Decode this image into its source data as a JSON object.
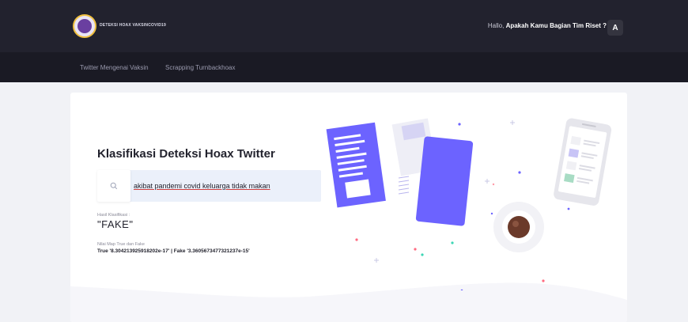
{
  "header": {
    "brand": "DETEKSI HOAX VAKSINCOVID19",
    "greeting_prefix": "Hallo,",
    "greeting_name": "Apakah Kamu Bagian Tim Riset ?",
    "avatar_letter": "A"
  },
  "nav": {
    "items": [
      {
        "label": "Twitter Mengenai Vaksin"
      },
      {
        "label": "Scrapping Turnbackhoax"
      }
    ]
  },
  "main": {
    "title": "Klasifikasi Deteksi Hoax Twitter",
    "search": {
      "value": "akibat pandemi covid keluarga tidak makan",
      "icon": "search-icon"
    },
    "result_label": "Hasil Klasifikasi :",
    "result_value": "\"FAKE\"",
    "score_label": "Nilai Map True dan Fake",
    "score_value": "True '8.304213925918202e-17' | Fake '3.3605673477321237e-15'"
  },
  "colors": {
    "topbar": "#22222e",
    "navbar": "#1a1a24",
    "accent": "#6c63ff",
    "background": "#f1f2f6"
  }
}
